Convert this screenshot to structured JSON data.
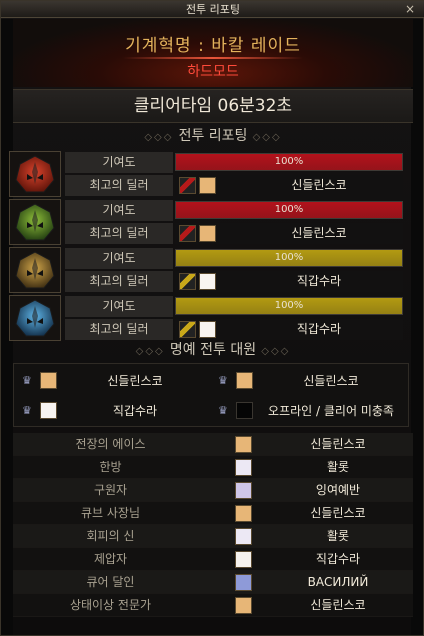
{
  "window": {
    "title": "전투 리포팅",
    "close": "×"
  },
  "header": {
    "raid_title": "기계혁명 : 바칼 레이드",
    "raid_mode": "하드모드"
  },
  "clear_time": "클리어타임  06분32초",
  "sections": {
    "report": "전투 리포팅",
    "honor": "명예 전투 대원"
  },
  "parties": [
    {
      "icon": "red-boss-icon",
      "contrib_label": "기여도",
      "contrib": "100%",
      "contrib_value": 1.0,
      "bar_color": "#b3121b",
      "dealer_label": "최고의 딜러",
      "dealer": "신들린스코",
      "weapon_color": "#b61a1a"
    },
    {
      "icon": "green-boss-icon",
      "contrib_label": "기여도",
      "contrib": "100%",
      "contrib_value": 1.0,
      "bar_color": "#b3121b",
      "dealer_label": "최고의 딜러",
      "dealer": "신들린스코",
      "weapon_color": "#b61a1a"
    },
    {
      "icon": "gold-boss-icon",
      "contrib_label": "기여도",
      "contrib": "100%",
      "contrib_value": 1.0,
      "bar_color": "#b39a12",
      "dealer_label": "최고의 딜러",
      "dealer": "직갑수라",
      "weapon_color": "#c9a81a"
    },
    {
      "icon": "blue-boss-icon",
      "contrib_label": "기여도",
      "contrib": "100%",
      "contrib_value": 1.0,
      "bar_color": "#b39a12",
      "dealer_label": "최고의 딜러",
      "dealer": "직갑수라",
      "weapon_color": "#c9a81a"
    }
  ],
  "honor": [
    {
      "name": "신들린스코",
      "avatar": "blonde-avatar-icon"
    },
    {
      "name": "신들린스코",
      "avatar": "blonde-avatar-icon"
    },
    {
      "name": "직갑수라",
      "avatar": "white-avatar-icon"
    },
    {
      "name": "오프라인 / 클리어 미충족",
      "avatar": "empty-avatar-icon"
    }
  ],
  "awards": [
    {
      "label": "전장의 에이스",
      "name": "신들린스코",
      "avatar_color": "#e7b677"
    },
    {
      "label": "한방",
      "name": "활롯",
      "avatar_color": "#ece8f4"
    },
    {
      "label": "구원자",
      "name": "잉여예반",
      "avatar_color": "#cfc6e8"
    },
    {
      "label": "큐브 사장님",
      "name": "신들린스코",
      "avatar_color": "#e7b677"
    },
    {
      "label": "회피의 신",
      "name": "활롯",
      "avatar_color": "#ece8f4"
    },
    {
      "label": "제압자",
      "name": "직갑수라",
      "avatar_color": "#f6f2ee"
    },
    {
      "label": "큐어 달인",
      "name": "ВАСИЛИЙ",
      "avatar_color": "#8e9ad8"
    },
    {
      "label": "상태이상 전문가",
      "name": "신들린스코",
      "avatar_color": "#e7b677"
    }
  ]
}
